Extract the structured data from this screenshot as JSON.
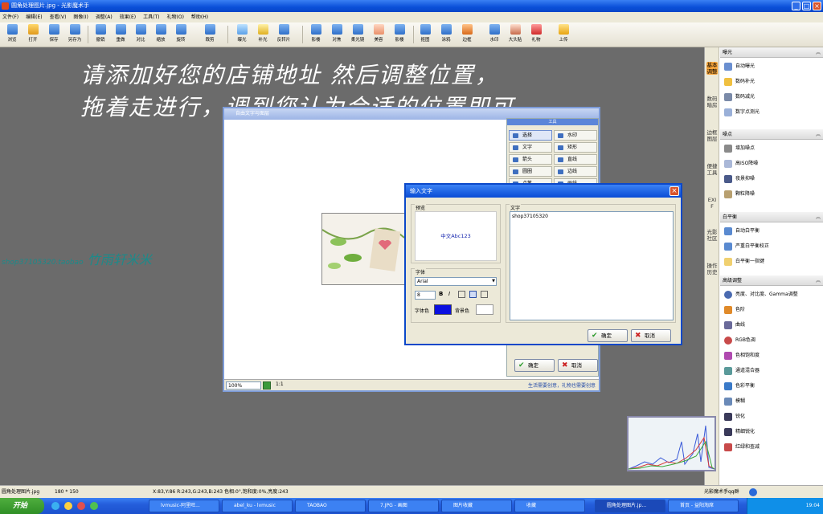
{
  "window": {
    "title": "圆角处理图片.jpg - 光影魔术手"
  },
  "menu": [
    "文件(F)",
    "编辑(E)",
    "查看(V)",
    "图像(I)",
    "调整(A)",
    "效果(E)",
    "工具(T)",
    "礼物(O)",
    "帮助(H)"
  ],
  "toolbar": [
    "浏览",
    "打开",
    "保存",
    "另存为",
    "撤销",
    "重做",
    "对比",
    "缩放",
    "旋转",
    "裁剪",
    "曝光",
    "补光",
    "反转片",
    "影楼",
    "对焦",
    "柔光镜",
    "美容",
    "影楼",
    "抠图",
    "涂鸦",
    "边框",
    "水印",
    "大头贴",
    "礼物",
    "上传"
  ],
  "overlay": {
    "line1": "请添加好您的店铺地址 然后调整位置，",
    "line2": "拖着走进行，调到您认为合适的位置即可",
    "shop_prefix": "shop37105320.",
    "shop_taobao": "taobao",
    "shop_name": "竹雨轩米米"
  },
  "editor": {
    "title": "自由文字与图层",
    "zoom": "100%",
    "ratio": "1:1",
    "footer": "生活需要创意，礼物也需要创意"
  },
  "tools": {
    "header": "工具",
    "items": [
      "选择",
      "水印",
      "文字",
      "矩形",
      "箭头",
      "直线",
      "圆圈",
      "边线",
      "点笔",
      "画线"
    ],
    "ok": "确定",
    "cancel": "取消"
  },
  "dialog": {
    "title": "输入文字",
    "preview_label": "预览",
    "preview_text": "中文Abc123",
    "text_label": "文字",
    "text_value": "shop37105320",
    "font_label": "字体",
    "font": "Arial",
    "size": "8",
    "bold": "B",
    "italic": "I",
    "font_color_label": "字体色",
    "bg_color_label": "背景色",
    "ok": "确定",
    "cancel": "取消",
    "font_color": "#0b10e0"
  },
  "vtabs": [
    "基本调整",
    "数码暗房",
    "边框图层",
    "便捷工具",
    "EXIF",
    "光影社区",
    "操作历史"
  ],
  "panel": {
    "exposure": {
      "title": "曝光",
      "items": [
        "自动曝光",
        "数码补光",
        "数码减光",
        "数字点测光"
      ]
    },
    "noise": {
      "title": "噪点",
      "items": [
        "增加噪点",
        "高ISO降噪",
        "夜景抑噪",
        "颗粒降噪"
      ]
    },
    "wb": {
      "title": "白平衡",
      "items": [
        "自动白平衡",
        "严重白平衡校正",
        "白平衡一指键"
      ]
    },
    "advanced": {
      "title": "高级调整",
      "items": [
        "亮度、对比度、Gamma调整",
        "色阶",
        "曲线",
        "RGB色调",
        "色相饱和度",
        "通道混合器",
        "色彩平衡",
        "模糊",
        "锐化",
        "精细锐化",
        "红绿和查减"
      ]
    }
  },
  "status": {
    "file": "圆角处理图片.jpg",
    "size": "180 * 150",
    "info": "X:83,Y:86 R:243,G:243,B:243 色相:0°,饱和度:0%,亮度:243",
    "right": "光影魔术手qq群"
  },
  "taskbar": {
    "start": "开始",
    "tasks": [
      "lvmusic-阿里旺...",
      "abel_ku - lvmusic",
      "TAOBAO",
      "7.JPG - 画图",
      "图片收藏",
      "收藏",
      "圆角处理图片.jp...",
      "首页 - 益阳淘席"
    ],
    "clock": "19:04"
  }
}
